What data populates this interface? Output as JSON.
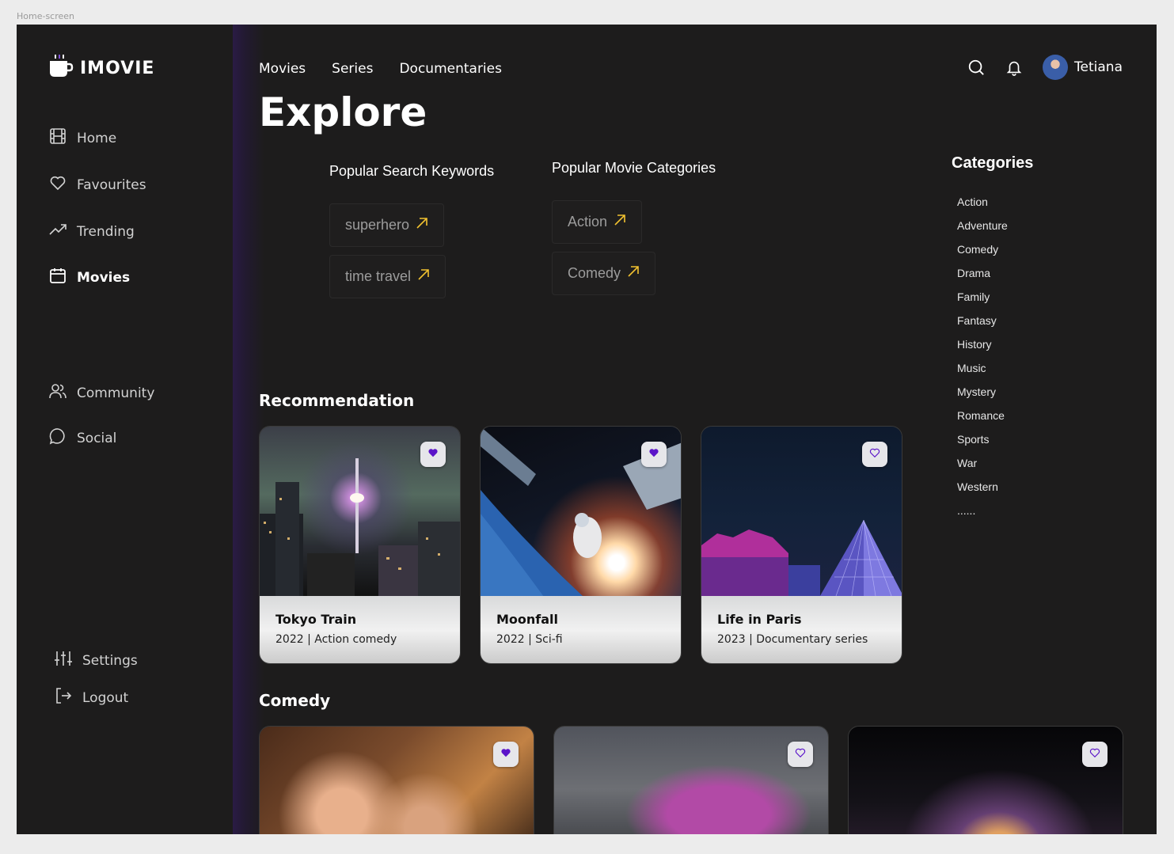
{
  "frame_label": "Home-screen",
  "brand": {
    "name": "IMOVIE"
  },
  "sidebar": {
    "items": [
      {
        "label": "Home",
        "icon": "film-icon"
      },
      {
        "label": "Favourites",
        "icon": "heart-icon"
      },
      {
        "label": "Trending",
        "icon": "trending-icon"
      },
      {
        "label": "Movies",
        "icon": "calendar-icon",
        "active": true
      },
      {
        "label": "Community",
        "icon": "users-icon"
      },
      {
        "label": "Social",
        "icon": "chat-icon"
      },
      {
        "label": "Settings",
        "icon": "sliders-icon"
      },
      {
        "label": "Logout",
        "icon": "logout-icon"
      }
    ]
  },
  "topnav": {
    "items": [
      "Movies",
      "Series",
      "Documentaries"
    ]
  },
  "user": {
    "name": "Tetiana"
  },
  "page_title": "Explore",
  "popular_keywords": {
    "title": "Popular Search Keywords",
    "items": [
      "superhero",
      "time travel"
    ]
  },
  "popular_categories": {
    "title": "Popular Movie Categories",
    "items": [
      "Action",
      "Comedy"
    ]
  },
  "categories": {
    "title": "Categories",
    "items": [
      "Action",
      "Adventure",
      "Comedy",
      "Drama",
      "Family",
      "Fantasy",
      "History",
      "Music",
      "Mystery",
      "Romance",
      "Sports",
      "War",
      "Western",
      "......"
    ]
  },
  "recommendation": {
    "title": "Recommendation",
    "cards": [
      {
        "title": "Tokyo Train",
        "subtitle": "2022 | Action comedy",
        "favourite": true
      },
      {
        "title": "Moonfall",
        "subtitle": "2022 | Sci-fi",
        "favourite": true
      },
      {
        "title": "Life in Paris",
        "subtitle": "2023 | Documentary series",
        "favourite": false
      }
    ]
  },
  "comedy": {
    "title": "Comedy",
    "cards": [
      {
        "favourite": true
      },
      {
        "favourite": false
      },
      {
        "favourite": false
      }
    ]
  },
  "colors": {
    "accent": "#5b14c9",
    "chip_arrow": "#f2c230",
    "background": "#1d1c1c"
  }
}
